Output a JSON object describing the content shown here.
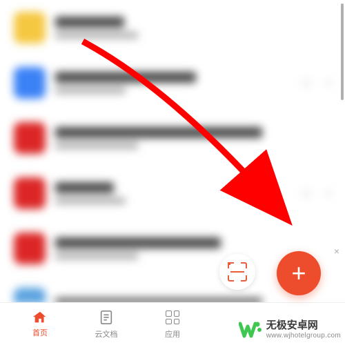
{
  "list": {
    "items": [
      {
        "icon_color": "icon-yellow",
        "title_width": "short"
      },
      {
        "icon_color": "icon-blue",
        "title_width": ""
      },
      {
        "icon_color": "icon-red",
        "title_width": "long"
      },
      {
        "icon_color": "icon-red",
        "title_width": "short"
      },
      {
        "icon_color": "icon-red",
        "title_width": ""
      },
      {
        "icon_color": "icon-lightblue",
        "title_width": "long"
      }
    ]
  },
  "fab": {
    "plus_label": "+",
    "close_label": "×"
  },
  "nav": {
    "home": "首页",
    "cloud_doc": "云文档",
    "apps": "应用"
  },
  "watermark": {
    "title": "无极安卓网",
    "url": "www.wjhotelgroup.com"
  },
  "colors": {
    "accent": "#ee4d2d",
    "fab": "#ee4d2d",
    "watermark_green": "#3fc751"
  }
}
